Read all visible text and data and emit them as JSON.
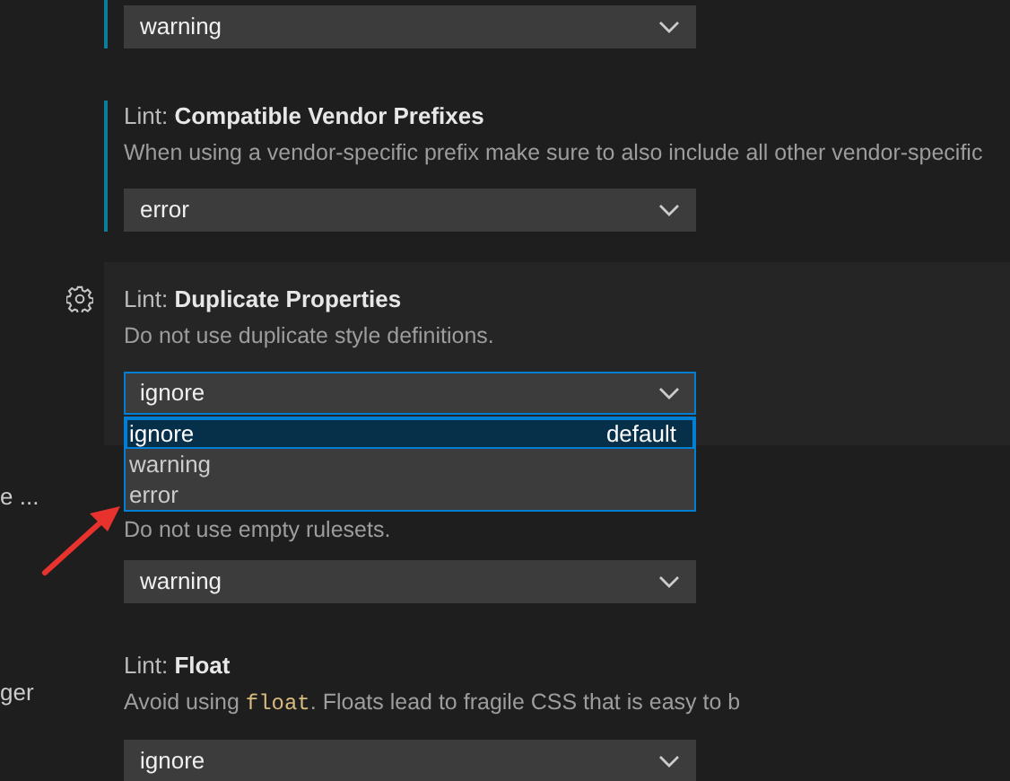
{
  "sidebar_fragments": [
    "e ...",
    "ger"
  ],
  "settings": [
    {
      "modified": true,
      "focused": false,
      "value": "warning"
    },
    {
      "modified": true,
      "focused": false,
      "category": "Lint:",
      "name": "Compatible Vendor Prefixes",
      "description": [
        {
          "kind": "text",
          "text": "When using a vendor-specific prefix make sure to also include all other vendor-specific"
        }
      ],
      "value": "error"
    },
    {
      "modified": false,
      "focused": true,
      "category": "Lint:",
      "name": "Duplicate Properties",
      "description": [
        {
          "kind": "text",
          "text": "Do not use duplicate style definitions."
        }
      ],
      "value": "ignore",
      "dropdown": {
        "options": [
          {
            "label": "ignore",
            "selected": true,
            "note": "default"
          },
          {
            "label": "warning",
            "selected": false
          },
          {
            "label": "error",
            "selected": false
          }
        ]
      }
    },
    {
      "modified": false,
      "focused": false,
      "description": [
        {
          "kind": "text",
          "text": "Do not use empty rulesets."
        }
      ],
      "value": "warning"
    },
    {
      "modified": false,
      "focused": false,
      "category": "Lint:",
      "name": "Float",
      "description": [
        {
          "kind": "text",
          "text": "Avoid using "
        },
        {
          "kind": "code",
          "text": "float"
        },
        {
          "kind": "text",
          "text": ". Floats lead to fragile CSS that is easy to b"
        }
      ],
      "value": "ignore"
    }
  ],
  "annotation": {
    "kind": "arrow",
    "color": "#e8322d"
  }
}
